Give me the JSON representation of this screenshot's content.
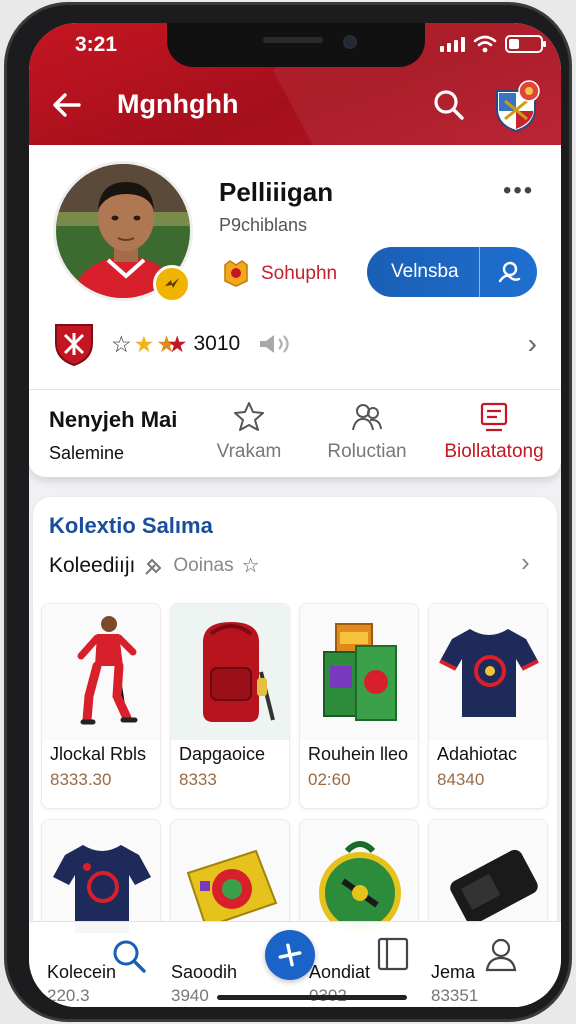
{
  "status_bar": {
    "time": "3:21"
  },
  "header": {
    "title": "Mgnhghh"
  },
  "profile": {
    "name": "Pelliiigan",
    "subtitle": "P9chiblans",
    "level_label": "Sohuphn",
    "member_button_label": "Velnsba",
    "more_label": "•••",
    "rating_value": "3010"
  },
  "tabs": {
    "main_title": "Nenyjeh Mai",
    "main_sub": "Salemine",
    "items": [
      {
        "label": "Vrakam"
      },
      {
        "label": "Roluctian"
      },
      {
        "label": "Biollatatong"
      }
    ]
  },
  "collection": {
    "title": "Kolextio Salıma",
    "subtitle": "Koleediıjı",
    "subtitle_muted": "Ooinas",
    "items": [
      {
        "name": "Jlockal Rbls",
        "price": "8333.30"
      },
      {
        "name": "Dapgaoice",
        "price": "8333"
      },
      {
        "name": "Rouhein lleo",
        "price": "02:60"
      },
      {
        "name": "Adahiotac",
        "price": "84340"
      }
    ]
  },
  "bottom_nav": {
    "items": [
      {
        "label": "Kolecein",
        "sub": "220.3"
      },
      {
        "label": "Saoodih",
        "sub": "3940"
      },
      {
        "label": "Aondiat",
        "sub": "0302"
      },
      {
        "label": "Jema",
        "sub": "83351"
      }
    ]
  },
  "colors": {
    "brand_red": "#c41622",
    "accent_blue": "#1a5fb4",
    "title_blue": "#1a4e9c",
    "gold": "#f0b400"
  }
}
